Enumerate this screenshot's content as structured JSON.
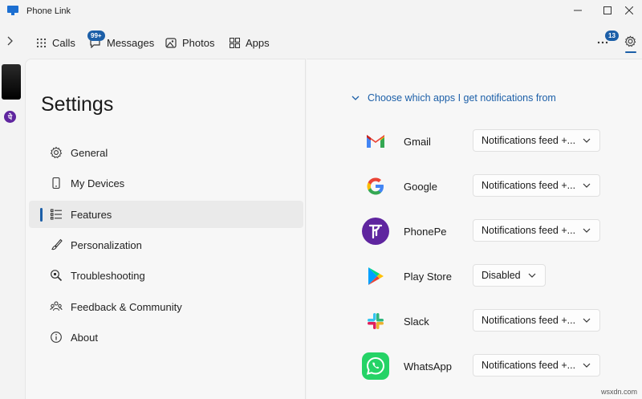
{
  "window": {
    "title": "Phone Link"
  },
  "nav": {
    "calls": "Calls",
    "messages": "Messages",
    "messages_badge": "99+",
    "photos": "Photos",
    "apps": "Apps",
    "more_badge": "13"
  },
  "settings": {
    "title": "Settings",
    "menu": [
      {
        "label": "General",
        "icon": "gear-icon"
      },
      {
        "label": "My Devices",
        "icon": "phone-icon"
      },
      {
        "label": "Features",
        "icon": "list-icon",
        "selected": true
      },
      {
        "label": "Personalization",
        "icon": "brush-icon"
      },
      {
        "label": "Troubleshooting",
        "icon": "troubleshoot-icon"
      },
      {
        "label": "Feedback & Community",
        "icon": "community-icon"
      },
      {
        "label": "About",
        "icon": "info-icon"
      }
    ]
  },
  "notifications": {
    "header": "Choose which apps I get notifications from",
    "apps": [
      {
        "name": "Gmail",
        "setting": "Notifications feed +...",
        "icon": "gmail-icon"
      },
      {
        "name": "Google",
        "setting": "Notifications feed +...",
        "icon": "google-icon"
      },
      {
        "name": "PhonePe",
        "setting": "Notifications feed +...",
        "icon": "phonepe-icon"
      },
      {
        "name": "Play Store",
        "setting": "Disabled",
        "icon": "play-store-icon"
      },
      {
        "name": "Slack",
        "setting": "Notifications feed +...",
        "icon": "slack-icon"
      },
      {
        "name": "WhatsApp",
        "setting": "Notifications feed +...",
        "icon": "whatsapp-icon"
      }
    ]
  },
  "watermark": "wsxdn.com",
  "colors": {
    "accent": "#1c5fa8",
    "background": "#f3f3f3",
    "panel": "#f7f7f7"
  }
}
